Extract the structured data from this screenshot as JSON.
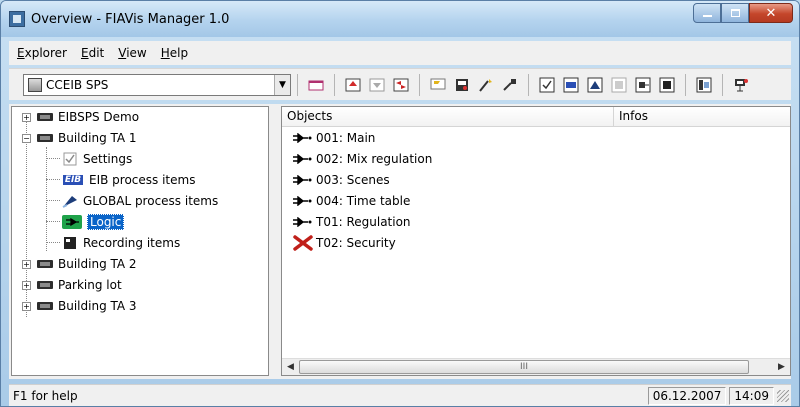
{
  "window": {
    "title": "Overview - FIAVis Manager 1.0"
  },
  "menu": {
    "items": [
      {
        "accel": "E",
        "rest": "xplorer"
      },
      {
        "accel": "E",
        "rest": "dit"
      },
      {
        "accel": "V",
        "rest": "iew"
      },
      {
        "accel": "H",
        "rest": "elp"
      }
    ]
  },
  "toolbar": {
    "combo_value": "CCEIB SPS"
  },
  "tree": {
    "nodes": [
      {
        "label": "EIBSPS Demo",
        "expander": "+"
      },
      {
        "label": "Building TA 1",
        "expander": "−"
      },
      {
        "label": "Settings"
      },
      {
        "label": "EIB process items"
      },
      {
        "label": "GLOBAL process items"
      },
      {
        "label": "Logic"
      },
      {
        "label": "Recording items"
      },
      {
        "label": "Building TA 2",
        "expander": "+"
      },
      {
        "label": "Parking lot",
        "expander": "+"
      },
      {
        "label": "Building TA 3",
        "expander": "+"
      }
    ],
    "eib_badge": "EIB"
  },
  "list": {
    "columns": [
      "Objects",
      "Infos"
    ],
    "rows": [
      {
        "label": "001: Main",
        "icon": "logic-icon"
      },
      {
        "label": "002: Mix regulation",
        "icon": "logic-icon"
      },
      {
        "label": "003: Scenes",
        "icon": "logic-icon"
      },
      {
        "label": "004: Time table",
        "icon": "logic-icon"
      },
      {
        "label": "T01: Regulation",
        "icon": "logic-icon"
      },
      {
        "label": "T02: Security",
        "icon": "security-icon"
      }
    ],
    "scroll_grip": "III"
  },
  "status": {
    "help": "F1 for help",
    "date": "06.12.2007",
    "time": "14:09"
  },
  "colors": {
    "selection": "#0a64c8",
    "logic_green": "#1fa24a",
    "security_red": "#c0201a"
  }
}
